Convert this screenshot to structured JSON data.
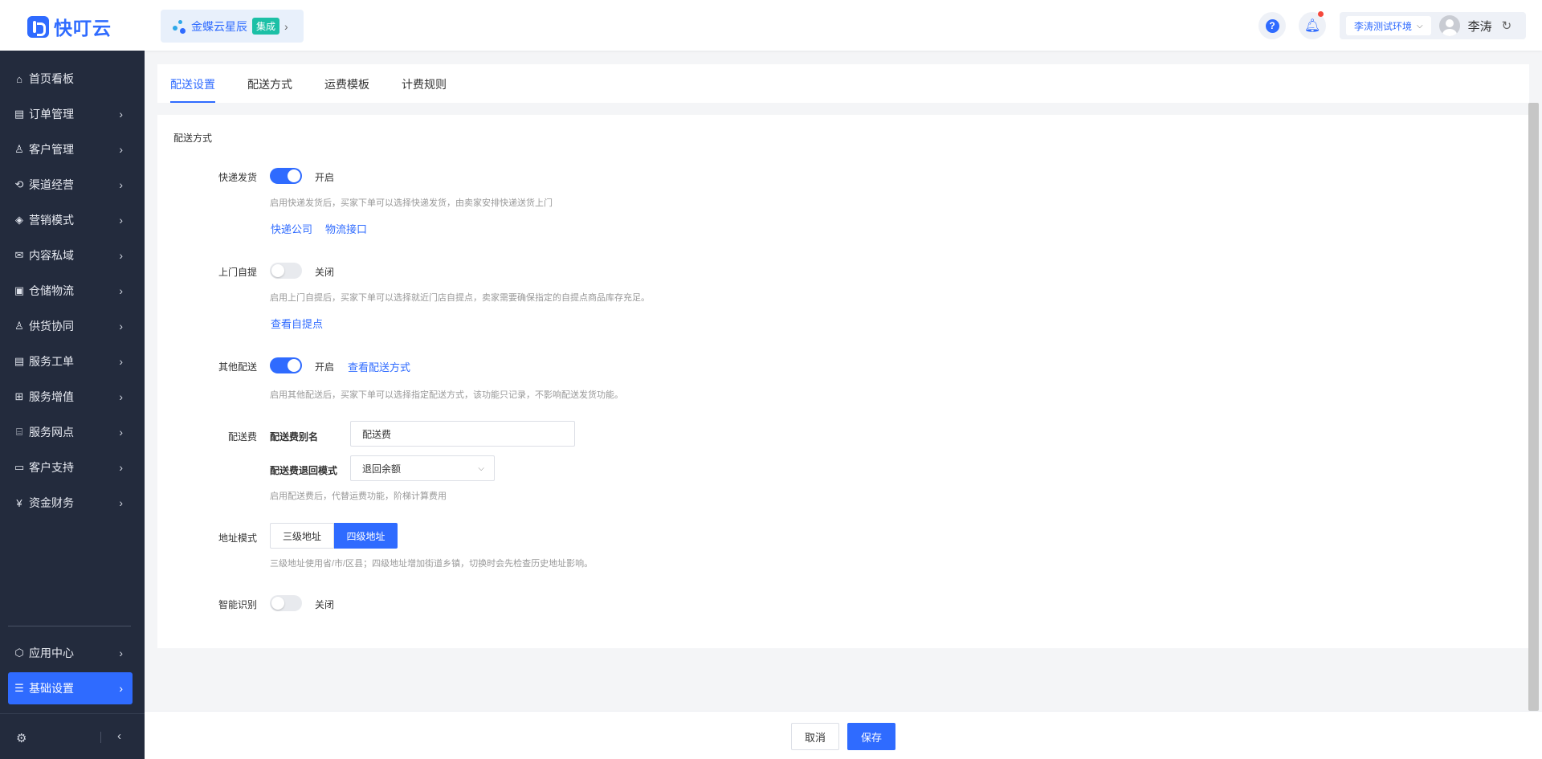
{
  "header": {
    "logo_text": "快叮云",
    "app_chip": {
      "name": "金蝶云星辰",
      "badge": "集成"
    },
    "env": "李涛测试环境",
    "user_name": "李涛"
  },
  "sidebar": {
    "items": [
      {
        "label": "首页看板",
        "icon": "home-icon"
      },
      {
        "label": "订单管理",
        "icon": "order-icon"
      },
      {
        "label": "客户管理",
        "icon": "customer-icon"
      },
      {
        "label": "渠道经营",
        "icon": "channel-icon"
      },
      {
        "label": "营销模式",
        "icon": "tag-icon"
      },
      {
        "label": "内容私域",
        "icon": "content-icon"
      },
      {
        "label": "仓储物流",
        "icon": "warehouse-icon"
      },
      {
        "label": "供货协同",
        "icon": "supply-icon"
      },
      {
        "label": "服务工单",
        "icon": "ticket-icon"
      },
      {
        "label": "服务增值",
        "icon": "bag-icon"
      },
      {
        "label": "服务网点",
        "icon": "store-icon"
      },
      {
        "label": "客户支持",
        "icon": "support-icon"
      },
      {
        "label": "资金财务",
        "icon": "yuan-icon"
      }
    ],
    "bottom_items": [
      {
        "label": "应用中心",
        "icon": "cube-icon"
      },
      {
        "label": "基础设置",
        "icon": "settings-icon"
      }
    ]
  },
  "tabs": [
    "配送设置",
    "配送方式",
    "运费模板",
    "计费规则"
  ],
  "panel": {
    "section_title": "配送方式",
    "express": {
      "label": "快递发货",
      "state": "开启",
      "hint": "启用快递发货后，买家下单可以选择快递发货，由卖家安排快递送货上门",
      "link1": "快递公司",
      "link2": "物流接口"
    },
    "pickup": {
      "label": "上门自提",
      "state": "关闭",
      "hint": "启用上门自提后，买家下单可以选择就近门店自提点，卖家需要确保指定的自提点商品库存充足。",
      "link": "查看自提点"
    },
    "other": {
      "label": "其他配送",
      "state": "开启",
      "link": "查看配送方式",
      "hint": "启用其他配送后，买家下单可以选择指定配送方式，该功能只记录，不影响配送发货功能。"
    },
    "fee": {
      "label": "配送费",
      "alias_label": "配送费别名",
      "alias_value": "配送费",
      "refund_label": "配送费退回模式",
      "refund_value": "退回余额",
      "hint": "启用配送费后，代替运费功能，阶梯计算费用"
    },
    "address": {
      "label": "地址模式",
      "option1": "三级地址",
      "option2": "四级地址",
      "hint": "三级地址使用省/市/区县；四级地址增加街道乡镇，切换时会先检查历史地址影响。"
    },
    "smart": {
      "label": "智能识别",
      "state": "关闭"
    }
  },
  "footer": {
    "cancel": "取消",
    "save": "保存"
  }
}
